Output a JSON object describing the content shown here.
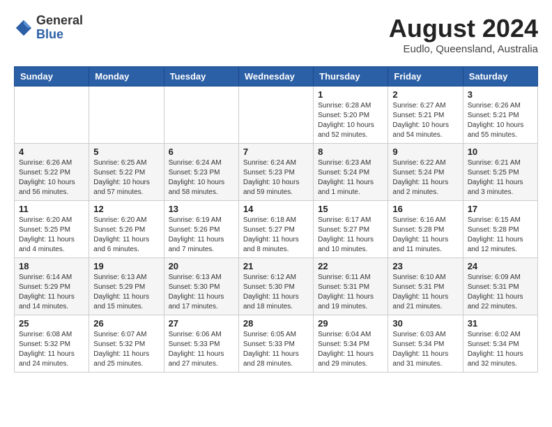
{
  "header": {
    "logo_general": "General",
    "logo_blue": "Blue",
    "month_year": "August 2024",
    "location": "Eudlo, Queensland, Australia"
  },
  "days_of_week": [
    "Sunday",
    "Monday",
    "Tuesday",
    "Wednesday",
    "Thursday",
    "Friday",
    "Saturday"
  ],
  "weeks": [
    [
      {
        "day": "",
        "info": ""
      },
      {
        "day": "",
        "info": ""
      },
      {
        "day": "",
        "info": ""
      },
      {
        "day": "",
        "info": ""
      },
      {
        "day": "1",
        "info": "Sunrise: 6:28 AM\nSunset: 5:20 PM\nDaylight: 10 hours\nand 52 minutes."
      },
      {
        "day": "2",
        "info": "Sunrise: 6:27 AM\nSunset: 5:21 PM\nDaylight: 10 hours\nand 54 minutes."
      },
      {
        "day": "3",
        "info": "Sunrise: 6:26 AM\nSunset: 5:21 PM\nDaylight: 10 hours\nand 55 minutes."
      }
    ],
    [
      {
        "day": "4",
        "info": "Sunrise: 6:26 AM\nSunset: 5:22 PM\nDaylight: 10 hours\nand 56 minutes."
      },
      {
        "day": "5",
        "info": "Sunrise: 6:25 AM\nSunset: 5:22 PM\nDaylight: 10 hours\nand 57 minutes."
      },
      {
        "day": "6",
        "info": "Sunrise: 6:24 AM\nSunset: 5:23 PM\nDaylight: 10 hours\nand 58 minutes."
      },
      {
        "day": "7",
        "info": "Sunrise: 6:24 AM\nSunset: 5:23 PM\nDaylight: 10 hours\nand 59 minutes."
      },
      {
        "day": "8",
        "info": "Sunrise: 6:23 AM\nSunset: 5:24 PM\nDaylight: 11 hours\nand 1 minute."
      },
      {
        "day": "9",
        "info": "Sunrise: 6:22 AM\nSunset: 5:24 PM\nDaylight: 11 hours\nand 2 minutes."
      },
      {
        "day": "10",
        "info": "Sunrise: 6:21 AM\nSunset: 5:25 PM\nDaylight: 11 hours\nand 3 minutes."
      }
    ],
    [
      {
        "day": "11",
        "info": "Sunrise: 6:20 AM\nSunset: 5:25 PM\nDaylight: 11 hours\nand 4 minutes."
      },
      {
        "day": "12",
        "info": "Sunrise: 6:20 AM\nSunset: 5:26 PM\nDaylight: 11 hours\nand 6 minutes."
      },
      {
        "day": "13",
        "info": "Sunrise: 6:19 AM\nSunset: 5:26 PM\nDaylight: 11 hours\nand 7 minutes."
      },
      {
        "day": "14",
        "info": "Sunrise: 6:18 AM\nSunset: 5:27 PM\nDaylight: 11 hours\nand 8 minutes."
      },
      {
        "day": "15",
        "info": "Sunrise: 6:17 AM\nSunset: 5:27 PM\nDaylight: 11 hours\nand 10 minutes."
      },
      {
        "day": "16",
        "info": "Sunrise: 6:16 AM\nSunset: 5:28 PM\nDaylight: 11 hours\nand 11 minutes."
      },
      {
        "day": "17",
        "info": "Sunrise: 6:15 AM\nSunset: 5:28 PM\nDaylight: 11 hours\nand 12 minutes."
      }
    ],
    [
      {
        "day": "18",
        "info": "Sunrise: 6:14 AM\nSunset: 5:29 PM\nDaylight: 11 hours\nand 14 minutes."
      },
      {
        "day": "19",
        "info": "Sunrise: 6:13 AM\nSunset: 5:29 PM\nDaylight: 11 hours\nand 15 minutes."
      },
      {
        "day": "20",
        "info": "Sunrise: 6:13 AM\nSunset: 5:30 PM\nDaylight: 11 hours\nand 17 minutes."
      },
      {
        "day": "21",
        "info": "Sunrise: 6:12 AM\nSunset: 5:30 PM\nDaylight: 11 hours\nand 18 minutes."
      },
      {
        "day": "22",
        "info": "Sunrise: 6:11 AM\nSunset: 5:31 PM\nDaylight: 11 hours\nand 19 minutes."
      },
      {
        "day": "23",
        "info": "Sunrise: 6:10 AM\nSunset: 5:31 PM\nDaylight: 11 hours\nand 21 minutes."
      },
      {
        "day": "24",
        "info": "Sunrise: 6:09 AM\nSunset: 5:31 PM\nDaylight: 11 hours\nand 22 minutes."
      }
    ],
    [
      {
        "day": "25",
        "info": "Sunrise: 6:08 AM\nSunset: 5:32 PM\nDaylight: 11 hours\nand 24 minutes."
      },
      {
        "day": "26",
        "info": "Sunrise: 6:07 AM\nSunset: 5:32 PM\nDaylight: 11 hours\nand 25 minutes."
      },
      {
        "day": "27",
        "info": "Sunrise: 6:06 AM\nSunset: 5:33 PM\nDaylight: 11 hours\nand 27 minutes."
      },
      {
        "day": "28",
        "info": "Sunrise: 6:05 AM\nSunset: 5:33 PM\nDaylight: 11 hours\nand 28 minutes."
      },
      {
        "day": "29",
        "info": "Sunrise: 6:04 AM\nSunset: 5:34 PM\nDaylight: 11 hours\nand 29 minutes."
      },
      {
        "day": "30",
        "info": "Sunrise: 6:03 AM\nSunset: 5:34 PM\nDaylight: 11 hours\nand 31 minutes."
      },
      {
        "day": "31",
        "info": "Sunrise: 6:02 AM\nSunset: 5:34 PM\nDaylight: 11 hours\nand 32 minutes."
      }
    ]
  ]
}
